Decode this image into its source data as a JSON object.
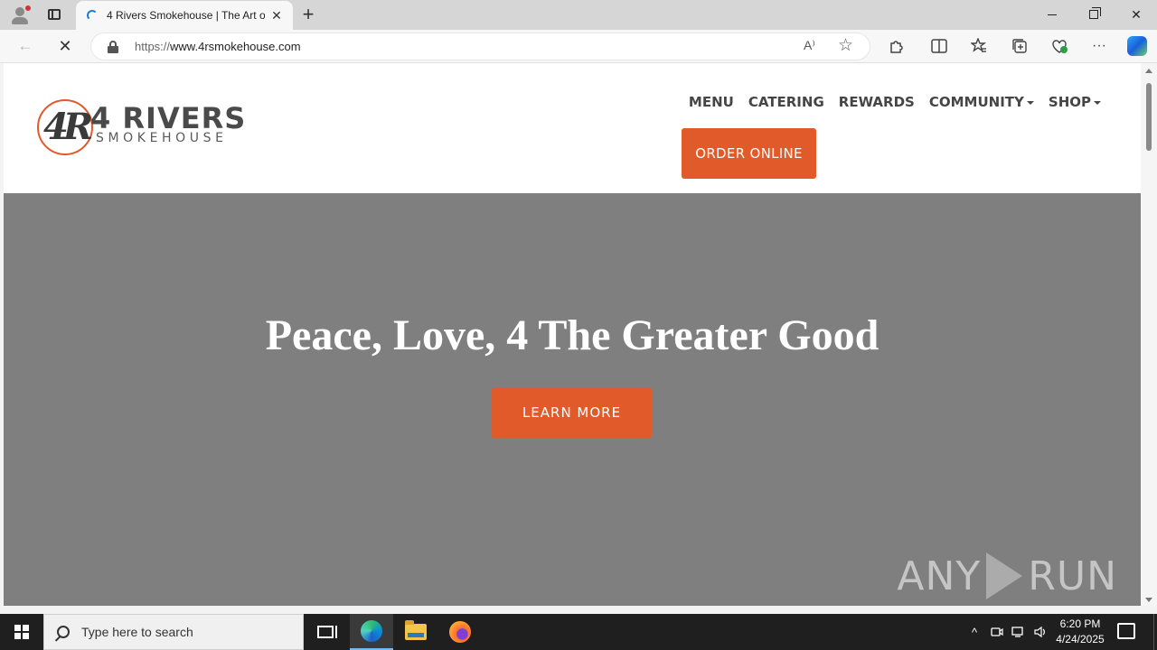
{
  "browser": {
    "tab_title": "4 Rivers Smokehouse | The Art of",
    "new_tab_symbol": "+",
    "url_protocol": "https://",
    "url_host": "www.4rsmokehouse.com",
    "read_aloud_symbol": "A⁾",
    "favorite_symbol": "☆",
    "more_symbol": "···",
    "back_symbol": "←",
    "stop_symbol": "✕",
    "close_symbol": "✕"
  },
  "site": {
    "logo": {
      "initials": "4R",
      "brand": "4 RIVERS",
      "sub": "SMOKEHOUSE"
    },
    "nav": {
      "menu": "MENU",
      "catering": "CATERING",
      "rewards": "REWARDS",
      "community": "COMMUNITY",
      "shop": "SHOP"
    },
    "order_button": "ORDER ONLINE",
    "hero": {
      "title": "Peace, Love, 4 The Greater Good",
      "button": "LEARN MORE"
    },
    "colors": {
      "accent": "#e05a2a",
      "hero_bg": "#7f7f7f",
      "nav_text": "#454545"
    }
  },
  "watermark": {
    "left": "ANY",
    "right": "RUN"
  },
  "taskbar": {
    "search_placeholder": "Type here to search",
    "time": "6:20 PM",
    "date": "4/24/2025",
    "tray_chevron": "^"
  }
}
